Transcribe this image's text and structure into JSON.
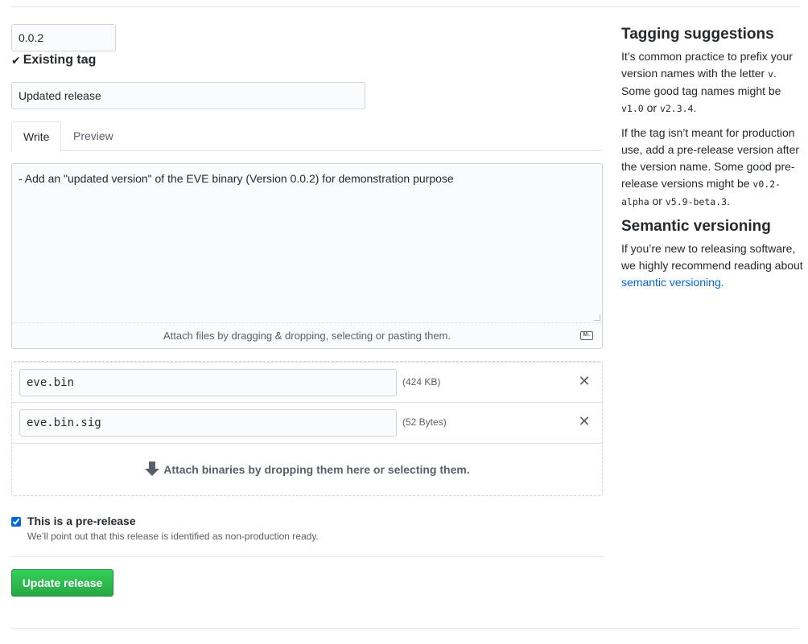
{
  "tag": {
    "value": "0.0.2",
    "status_label": "Existing tag"
  },
  "release_title": {
    "value": "Updated release"
  },
  "editor": {
    "tabs": [
      {
        "label": "Write"
      },
      {
        "label": "Preview"
      }
    ],
    "body": "- Add an \"updated version\" of the EVE binary (Version 0.0.2) for demonstration purpose",
    "attach_hint": "Attach files by dragging & dropping, selecting or pasting them.",
    "markdown_icon": "markdown-icon"
  },
  "assets": {
    "files": [
      {
        "name": "eve.bin",
        "size": "(424 KB)"
      },
      {
        "name": "eve.bin.sig",
        "size": "(52 Bytes)"
      }
    ],
    "drop_hint": "Attach binaries by dropping them here or selecting them."
  },
  "prerelease": {
    "checked": true,
    "label": "This is a pre-release",
    "note": "We’ll point out that this release is identified as non-production ready."
  },
  "submit": {
    "label": "Update release"
  },
  "sidebar": {
    "tagging_title": "Tagging suggestions",
    "tagging_p1_a": "It’s common practice to prefix your version names with the letter ",
    "tagging_p1_code1": "v",
    "tagging_p1_b": ". Some good tag names might be ",
    "tagging_p1_code2": "v1.0",
    "tagging_p1_c": " or ",
    "tagging_p1_code3": "v2.3.4",
    "tagging_p1_d": ".",
    "tagging_p2_a": "If the tag isn’t meant for production use, add a pre-release version after the version name. Some good pre-release versions might be ",
    "tagging_p2_code1": "v0.2-alpha",
    "tagging_p2_b": " or ",
    "tagging_p2_code2": "v5.9-beta.3",
    "tagging_p2_c": ".",
    "semver_title": "Semantic versioning",
    "semver_p_a": "If you’re new to releasing software, we highly recommend reading about ",
    "semver_link": "semantic versioning.",
    "semver_p_b": ""
  },
  "colors": {
    "primary_button": "#28a745",
    "link": "#0366d6",
    "border": "#d1d5da"
  }
}
